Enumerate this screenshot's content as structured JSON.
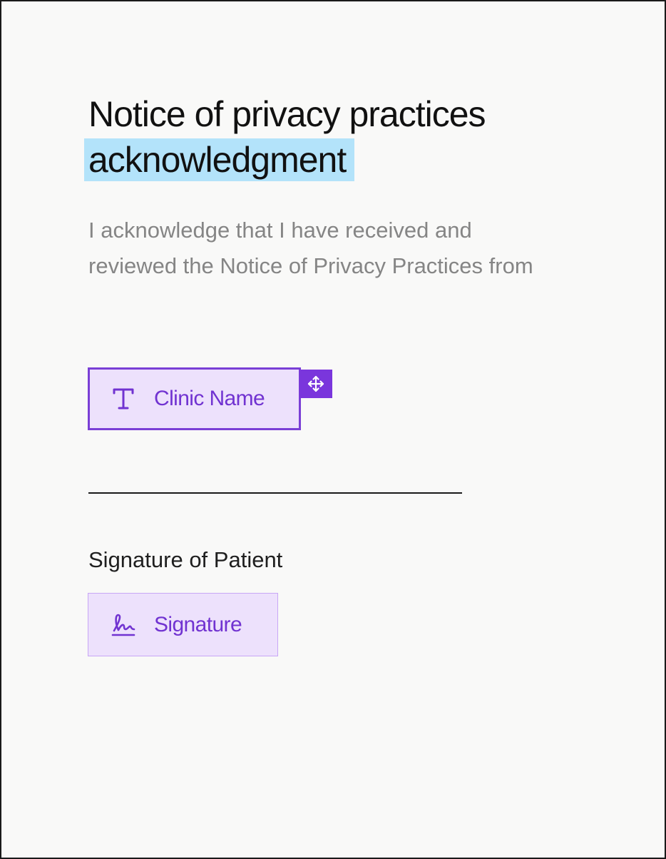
{
  "document": {
    "title_line1": "Notice of privacy practices",
    "title_line2": "acknowledgment",
    "body": "I acknowledge that I have received and reviewed the Notice of Privacy Practices from",
    "signature_caption": "Signature of Patient"
  },
  "fields": {
    "clinic_name": {
      "label": "Clinic Name",
      "icon": "text-field-icon"
    },
    "signature": {
      "label": "Signature",
      "icon": "signature-icon"
    },
    "move_handle_icon": "move-arrows-icon"
  },
  "colors": {
    "highlight": "#b3e3fa",
    "field_fill": "#ede1fc",
    "field_border": "#7a3fd6",
    "field_text": "#7133d1",
    "body_text": "#858585"
  }
}
